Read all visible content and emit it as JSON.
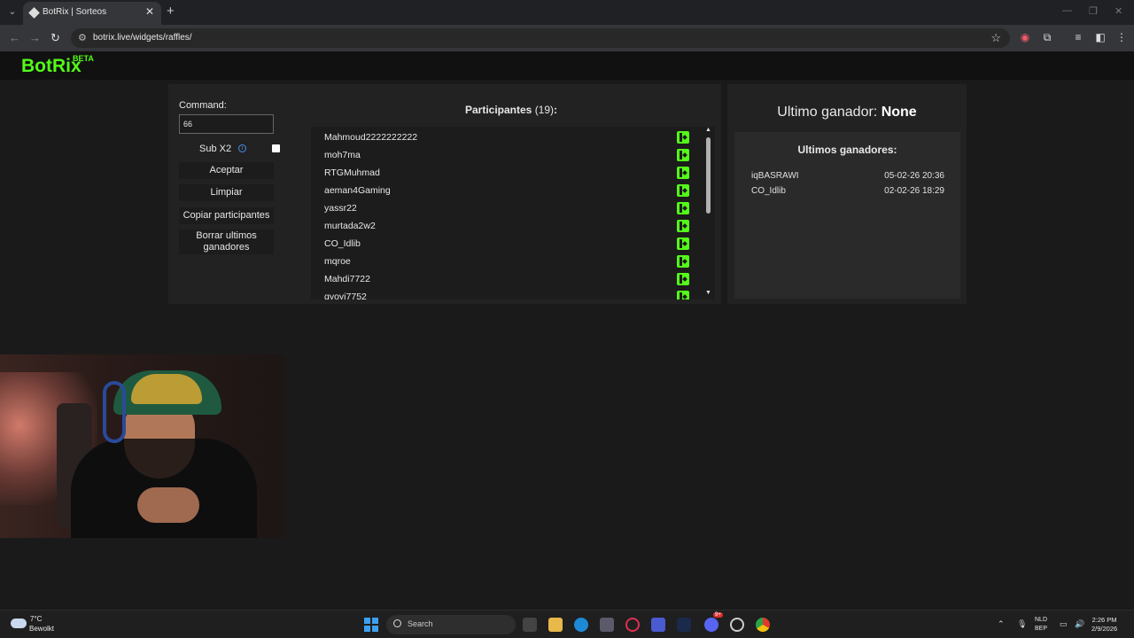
{
  "browser": {
    "tab_title": "BotRix | Sorteos",
    "url": "botrix.live/widgets/raffles/"
  },
  "header": {
    "logo": "BotRix",
    "badge": "BETA"
  },
  "controls": {
    "command_label": "Command:",
    "command_value": "66",
    "sub_label": "Sub X2",
    "sub_checked": false,
    "accept_label": "Aceptar",
    "clear_label": "Limpiar",
    "copy_label": "Copiar participantes",
    "delete_label": "Borrar ultimos ganadores"
  },
  "participants": {
    "title": "Participantes",
    "count": "(19)",
    "colon": ":",
    "items": [
      {
        "name": "Mahmoud2222222222"
      },
      {
        "name": "moh7ma"
      },
      {
        "name": "RTGMuhmad"
      },
      {
        "name": "aeman4Gaming"
      },
      {
        "name": "yassr22"
      },
      {
        "name": "murtada2w2"
      },
      {
        "name": "CO_Idlib"
      },
      {
        "name": "mqroe"
      },
      {
        "name": "Mahdi7722"
      },
      {
        "name": "qyoyi7752"
      }
    ]
  },
  "last_winner": {
    "label": "Ultimo ganador:",
    "value": "None"
  },
  "recent_winners": {
    "title": "Ultimos ganadores:",
    "items": [
      {
        "name": "iqBASRAWI",
        "date": "05-02-26 20:36"
      },
      {
        "name": "CO_Idlib",
        "date": "02-02-26 18:29"
      }
    ]
  },
  "taskbar": {
    "temp": "7°C",
    "weather": "Bewolkt",
    "search": "Search",
    "lang_1": "NLD",
    "lang_2": "BEP",
    "time": "2:26 PM",
    "date": "2/9/2026",
    "discord_badge": "9+"
  },
  "colors": {
    "brand": "#53fc18",
    "background": "#1a1a1a",
    "panel": "#222222"
  }
}
